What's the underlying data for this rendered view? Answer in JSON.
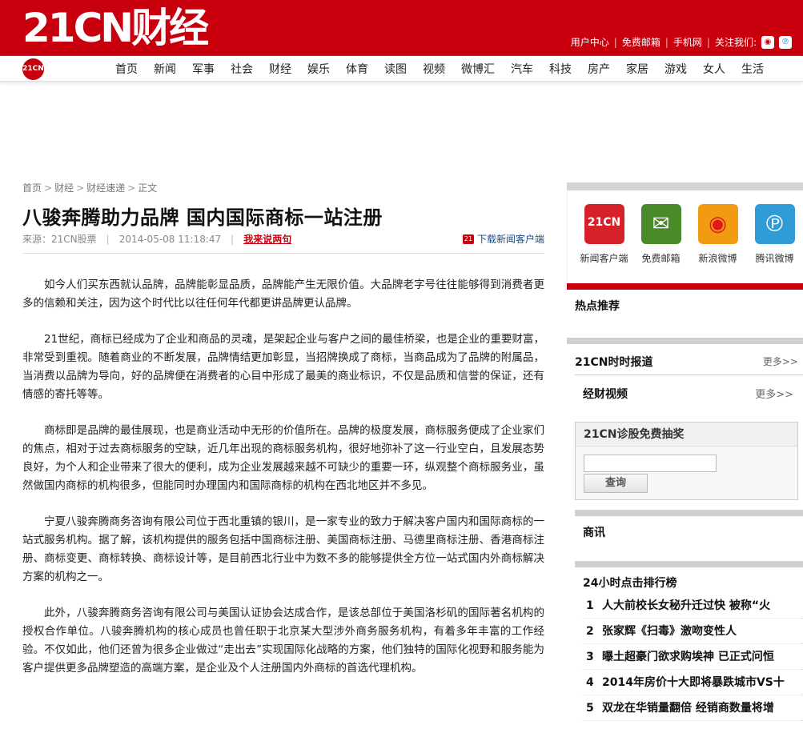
{
  "header": {
    "logo": "21CN财经",
    "top_links": [
      "用户中心",
      "免费邮箱",
      "手机网",
      "关注我们:"
    ],
    "nav_logo": "21CN",
    "nav": [
      "首页",
      "新闻",
      "军事",
      "社会",
      "财经",
      "娱乐",
      "体育",
      "读图",
      "视频",
      "微博汇",
      "汽车",
      "科技",
      "房产",
      "家居",
      "游戏",
      "女人",
      "生活"
    ]
  },
  "article": {
    "breadcrumb": [
      "首页",
      "财经",
      "财经速递",
      "正文"
    ],
    "title": "八骏奔腾助力品牌 国内国际商标一站注册",
    "source": "来源：21CN股票",
    "datetime": "2014-05-08 11:18:47",
    "comment_link": "我来说两句",
    "client_icon": "21",
    "client_link": "下载新闻客户端",
    "paragraphs": [
      "如今人们买东西就认品牌，品牌能彰显品质，品牌能产生无限价值。大品牌老字号往往能够得到消费者更多的信赖和关注，因为这个时代比以往任何年代都更讲品牌更认品牌。",
      "21世纪，商标已经成为了企业和商品的灵魂，是架起企业与客户之间的最佳桥梁，也是企业的重要财富，非常受到重视。随着商业的不断发展，品牌情结更加彰显，当招牌换成了商标，当商品成为了品牌的附属品，当消费以品牌为导向，好的品牌便在消费者的心目中形成了最美的商业标识，不仅是品质和信誉的保证，还有情感的寄托等等。",
      "商标即是品牌的最佳展现，也是商业活动中无形的价值所在。品牌的极度发展，商标服务便成了企业家们的焦点，相对于过去商标服务的空缺，近几年出现的商标服务机构，很好地弥补了这一行业空白，且发展态势良好，为个人和企业带来了很大的便利，成为企业发展越来越不可缺少的重要一环，纵观整个商标服务业，虽然做国内商标的机构很多，但能同时办理国内和国际商标的机构在西北地区并不多见。",
      "宁夏八骏奔腾商务咨询有限公司位于西北重镇的银川，是一家专业的致力于解决客户国内和国际商标的一站式服务机构。据了解，该机构提供的服务包括中国商标注册、美国商标注册、马德里商标注册、香港商标注册、商标变更、商标转换、商标设计等，是目前西北行业中为数不多的能够提供全方位一站式国内外商标解决方案的机构之一。",
      "此外，八骏奔腾商务咨询有限公司与美国认证协会达成合作，是该总部位于美国洛杉矶的国际著名机构的授权合作单位。八骏奔腾机构的核心成员也曾任职于北京某大型涉外商务服务机构，有着多年丰富的工作经验。不仅如此，他们还曾为很多企业做过“走出去”实现国际化战略的方案，他们独特的国际化视野和服务能为客户提供更多品牌塑造的高端方案，是企业及个人注册国内外商标的首选代理机构。"
    ]
  },
  "sidebar": {
    "apps": [
      {
        "label": "新闻客户端",
        "icon_text": "21CN",
        "icon": "news-app-icon"
      },
      {
        "label": "免费邮箱",
        "icon_text": "✉",
        "icon": "mail-icon"
      },
      {
        "label": "新浪微博",
        "icon_text": "◉",
        "icon": "sina-weibo-icon"
      },
      {
        "label": "腾讯微博",
        "icon_text": "℗",
        "icon": "tencent-weibo-icon"
      }
    ],
    "hot": "热点推荐",
    "news_report": "21CN时时报道",
    "more1": "更多>>",
    "video": "经财视频",
    "more2": "更多>>",
    "lottery_title": "21CN诊股免费抽奖",
    "query_button": "查询",
    "business": "商讯",
    "rank_title": "24小时点击排行榜",
    "rank": [
      {
        "n": "1",
        "t": "人大前校长女秘升迁过快 被称“火"
      },
      {
        "n": "2",
        "t": "张家辉《扫毒》激吻变性人"
      },
      {
        "n": "3",
        "t": "曝土超豪门欲求购埃神 已正式问恒"
      },
      {
        "n": "4",
        "t": "2014年房价十大即将暴跌城市VS十"
      },
      {
        "n": "5",
        "t": "双龙在华销量翻倍 经销商数量将增"
      }
    ]
  },
  "colors": {
    "brand_red": "#c8000d",
    "link_blue": "#1a4c8b"
  }
}
